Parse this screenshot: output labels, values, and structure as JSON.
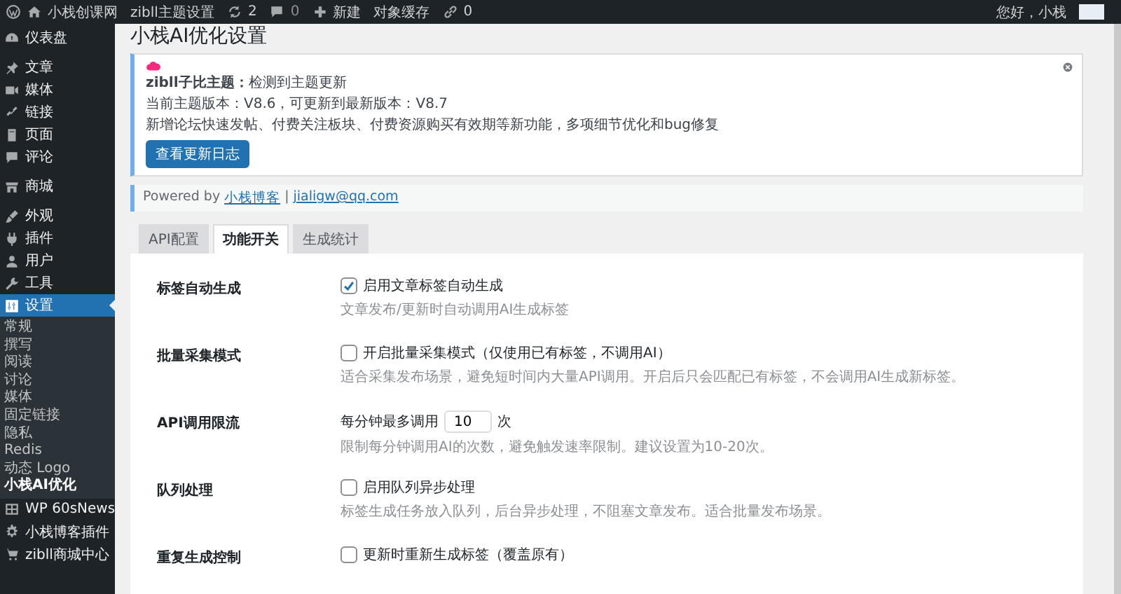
{
  "admin_bar": {
    "site_name": "小栈创课网",
    "theme_settings": "zibll主题设置",
    "updates_count": "2",
    "comments_count": "0",
    "new_label": "新建",
    "cache_label": "对象缓存",
    "links_count": "0",
    "greeting": "您好，小栈"
  },
  "sidebar": {
    "groups": [
      {
        "items": [
          {
            "label": "仪表盘",
            "selected": false
          }
        ]
      },
      {
        "items": [
          {
            "label": "文章",
            "selected": false
          },
          {
            "label": "媒体",
            "selected": false
          },
          {
            "label": "链接",
            "selected": false
          },
          {
            "label": "页面",
            "selected": false
          },
          {
            "label": "评论",
            "selected": false
          }
        ]
      },
      {
        "items": [
          {
            "label": "商城",
            "selected": false
          }
        ]
      },
      {
        "items": [
          {
            "label": "外观",
            "selected": false
          },
          {
            "label": "插件",
            "selected": false
          },
          {
            "label": "用户",
            "selected": false
          },
          {
            "label": "工具",
            "selected": false
          },
          {
            "label": "设置",
            "selected": true,
            "children": [
              {
                "label": "常规",
                "selected": false
              },
              {
                "label": "撰写",
                "selected": false
              },
              {
                "label": "阅读",
                "selected": false
              },
              {
                "label": "讨论",
                "selected": false
              },
              {
                "label": "媒体",
                "selected": false
              },
              {
                "label": "固定链接",
                "selected": false
              },
              {
                "label": "隐私",
                "selected": false
              },
              {
                "label": "Redis",
                "selected": false
              },
              {
                "label": "动态 Logo",
                "selected": false
              },
              {
                "label": "小栈AI优化",
                "selected": true
              }
            ]
          },
          {
            "label": "WP 60sNews",
            "selected": false
          },
          {
            "label": "小栈博客插件",
            "selected": false
          },
          {
            "label": "zibll商城中心",
            "selected": false
          }
        ]
      }
    ]
  },
  "page_title": "小栈AI优化设置",
  "notice": {
    "heading": "**zibll子比主题：**检测到主题更新",
    "version_line": "当前主题版本：V8.6，可更新到最新版本：V8.7",
    "changes": "新增论坛快速发帖、付费关注板块、付费资源购买有效期等新功能，多项细节优化和bug修复",
    "button": "查看更新日志"
  },
  "powered": {
    "prefix": "Powered by",
    "link": "小栈博客",
    "separator": "|",
    "email": "jialigw@qq.com"
  },
  "tabs": [
    {
      "label": "API配置",
      "selected": false
    },
    {
      "label": "功能开关",
      "selected": true
    },
    {
      "label": "生成统计",
      "selected": false
    }
  ],
  "settings": [
    {
      "kind": "checkbox",
      "label": "标签自动生成",
      "option": "启用文章标签自动生成",
      "checked": true,
      "description": "文章发布/更新时自动调用AI生成标签"
    },
    {
      "kind": "checkbox",
      "label": "批量采集模式",
      "option": "开启批量采集模式（仅使用已有标签，不调用AI）",
      "checked": false,
      "description": "适合采集发布场景，避免短时间内大量API调用。开启后只会匹配已有标签，不会调用AI生成新标签。"
    },
    {
      "kind": "number",
      "label": "API调用限流",
      "prefix": "每分钟最多调用",
      "value": "10",
      "suffix": "次",
      "description": "限制每分钟调用AI的次数，避免触发速率限制。建议设置为10-20次。"
    },
    {
      "kind": "checkbox",
      "label": "队列处理",
      "option": "启用队列异步处理",
      "checked": false,
      "description": "标签生成任务放入队列，后台异步处理，不阻塞文章发布。适合批量发布场景。"
    },
    {
      "kind": "checkbox",
      "label": "重复生成控制",
      "option": "更新时重新生成标签（覆盖原有）",
      "checked": false
    }
  ]
}
